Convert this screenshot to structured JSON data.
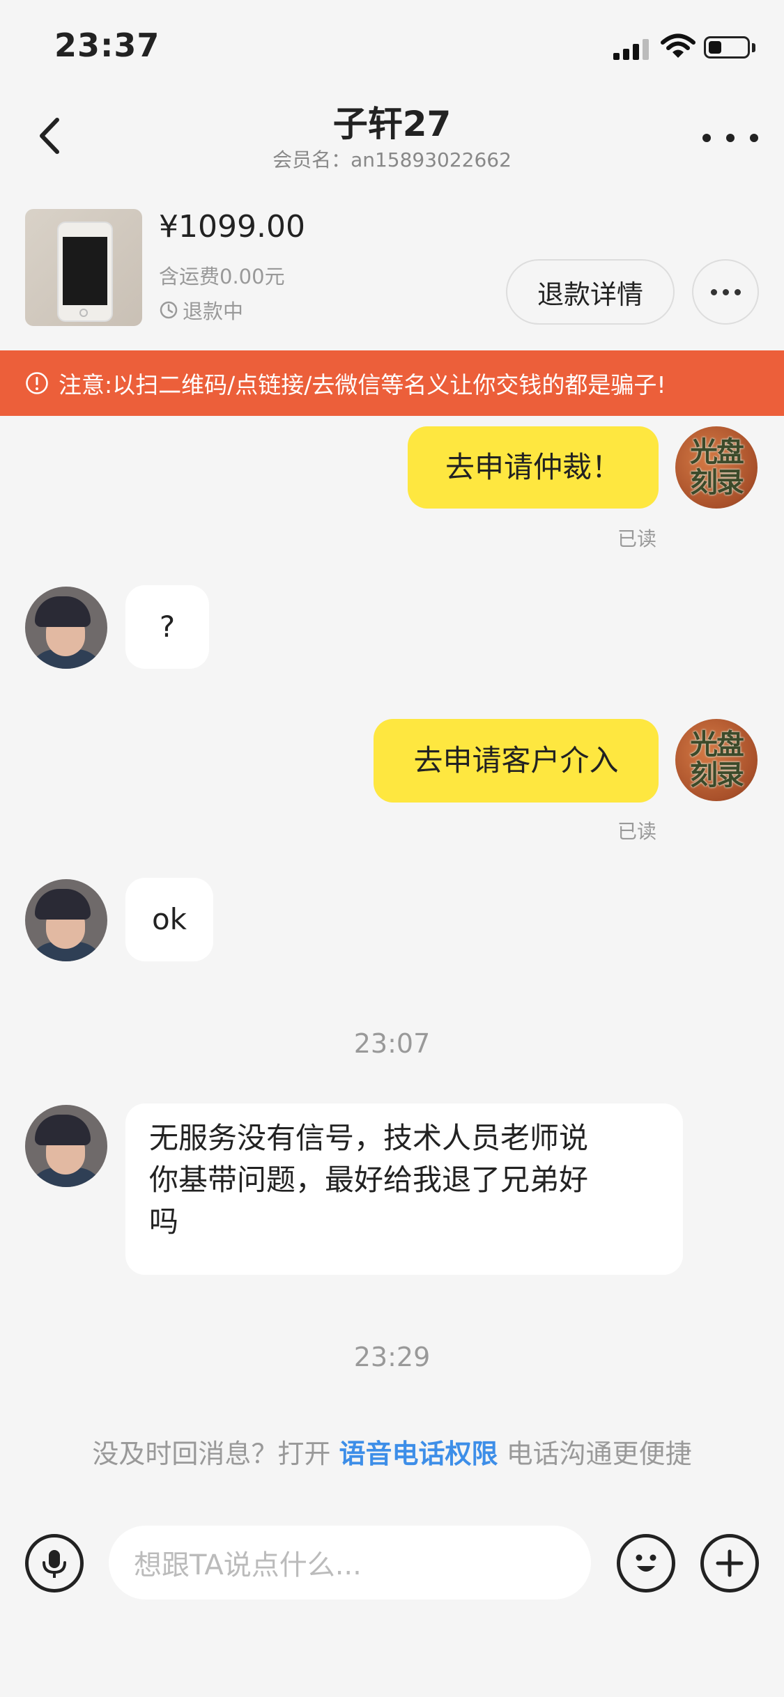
{
  "status_bar": {
    "time": "23:37",
    "battery_level": 0.35
  },
  "header": {
    "title": "子轩27",
    "subtitle": "会员名：an15893022662"
  },
  "product": {
    "price": "¥1099.00",
    "shipping": "含运费0.00元",
    "status": "退款中",
    "refund_detail_label": "退款详情"
  },
  "warning": {
    "text": "注意:以扫二维码/点链接/去微信等名义让你交钱的都是骗子!"
  },
  "avatar_me_text": [
    "光盘",
    "刻录"
  ],
  "messages": [
    {
      "sender": "me",
      "text": "去申请仲裁！",
      "read": "已读"
    },
    {
      "sender": "other",
      "text": "?"
    },
    {
      "sender": "me",
      "text": "去申请客户介入",
      "read": "已读"
    },
    {
      "sender": "other",
      "text": "ok"
    },
    {
      "sender": "time",
      "text": "23:07"
    },
    {
      "sender": "other",
      "lines": [
        "无服务没有信号，技术人员老师说",
        "你基带问题，最好给我退了兄弟好",
        "吗"
      ]
    },
    {
      "sender": "time",
      "text": "23:29"
    }
  ],
  "tip": {
    "before": "没及时回消息？打开 ",
    "link": "语音电话权限",
    "after": " 电话沟通更便捷"
  },
  "input": {
    "placeholder": "想跟TA说点什么..."
  },
  "icons": [
    "back-icon",
    "more-icon",
    "clock-icon",
    "warning-icon",
    "microphone-icon",
    "emoji-icon",
    "plus-icon"
  ]
}
